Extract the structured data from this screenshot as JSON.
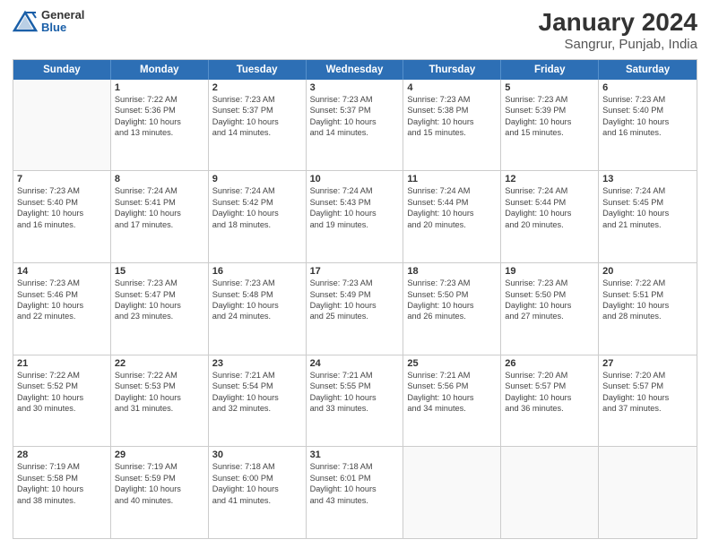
{
  "header": {
    "logo": {
      "general": "General",
      "blue": "Blue"
    },
    "title": "January 2024",
    "subtitle": "Sangrur, Punjab, India"
  },
  "days_of_week": [
    "Sunday",
    "Monday",
    "Tuesday",
    "Wednesday",
    "Thursday",
    "Friday",
    "Saturday"
  ],
  "weeks": [
    [
      {
        "day": "",
        "sunrise": "",
        "sunset": "",
        "daylight": "",
        "empty": true
      },
      {
        "day": "1",
        "sunrise": "Sunrise: 7:22 AM",
        "sunset": "Sunset: 5:36 PM",
        "daylight1": "Daylight: 10 hours",
        "daylight2": "and 13 minutes."
      },
      {
        "day": "2",
        "sunrise": "Sunrise: 7:23 AM",
        "sunset": "Sunset: 5:37 PM",
        "daylight1": "Daylight: 10 hours",
        "daylight2": "and 14 minutes."
      },
      {
        "day": "3",
        "sunrise": "Sunrise: 7:23 AM",
        "sunset": "Sunset: 5:37 PM",
        "daylight1": "Daylight: 10 hours",
        "daylight2": "and 14 minutes."
      },
      {
        "day": "4",
        "sunrise": "Sunrise: 7:23 AM",
        "sunset": "Sunset: 5:38 PM",
        "daylight1": "Daylight: 10 hours",
        "daylight2": "and 15 minutes."
      },
      {
        "day": "5",
        "sunrise": "Sunrise: 7:23 AM",
        "sunset": "Sunset: 5:39 PM",
        "daylight1": "Daylight: 10 hours",
        "daylight2": "and 15 minutes."
      },
      {
        "day": "6",
        "sunrise": "Sunrise: 7:23 AM",
        "sunset": "Sunset: 5:40 PM",
        "daylight1": "Daylight: 10 hours",
        "daylight2": "and 16 minutes."
      }
    ],
    [
      {
        "day": "7",
        "sunrise": "Sunrise: 7:23 AM",
        "sunset": "Sunset: 5:40 PM",
        "daylight1": "Daylight: 10 hours",
        "daylight2": "and 16 minutes."
      },
      {
        "day": "8",
        "sunrise": "Sunrise: 7:24 AM",
        "sunset": "Sunset: 5:41 PM",
        "daylight1": "Daylight: 10 hours",
        "daylight2": "and 17 minutes."
      },
      {
        "day": "9",
        "sunrise": "Sunrise: 7:24 AM",
        "sunset": "Sunset: 5:42 PM",
        "daylight1": "Daylight: 10 hours",
        "daylight2": "and 18 minutes."
      },
      {
        "day": "10",
        "sunrise": "Sunrise: 7:24 AM",
        "sunset": "Sunset: 5:43 PM",
        "daylight1": "Daylight: 10 hours",
        "daylight2": "and 19 minutes."
      },
      {
        "day": "11",
        "sunrise": "Sunrise: 7:24 AM",
        "sunset": "Sunset: 5:44 PM",
        "daylight1": "Daylight: 10 hours",
        "daylight2": "and 20 minutes."
      },
      {
        "day": "12",
        "sunrise": "Sunrise: 7:24 AM",
        "sunset": "Sunset: 5:44 PM",
        "daylight1": "Daylight: 10 hours",
        "daylight2": "and 20 minutes."
      },
      {
        "day": "13",
        "sunrise": "Sunrise: 7:24 AM",
        "sunset": "Sunset: 5:45 PM",
        "daylight1": "Daylight: 10 hours",
        "daylight2": "and 21 minutes."
      }
    ],
    [
      {
        "day": "14",
        "sunrise": "Sunrise: 7:23 AM",
        "sunset": "Sunset: 5:46 PM",
        "daylight1": "Daylight: 10 hours",
        "daylight2": "and 22 minutes."
      },
      {
        "day": "15",
        "sunrise": "Sunrise: 7:23 AM",
        "sunset": "Sunset: 5:47 PM",
        "daylight1": "Daylight: 10 hours",
        "daylight2": "and 23 minutes."
      },
      {
        "day": "16",
        "sunrise": "Sunrise: 7:23 AM",
        "sunset": "Sunset: 5:48 PM",
        "daylight1": "Daylight: 10 hours",
        "daylight2": "and 24 minutes."
      },
      {
        "day": "17",
        "sunrise": "Sunrise: 7:23 AM",
        "sunset": "Sunset: 5:49 PM",
        "daylight1": "Daylight: 10 hours",
        "daylight2": "and 25 minutes."
      },
      {
        "day": "18",
        "sunrise": "Sunrise: 7:23 AM",
        "sunset": "Sunset: 5:50 PM",
        "daylight1": "Daylight: 10 hours",
        "daylight2": "and 26 minutes."
      },
      {
        "day": "19",
        "sunrise": "Sunrise: 7:23 AM",
        "sunset": "Sunset: 5:50 PM",
        "daylight1": "Daylight: 10 hours",
        "daylight2": "and 27 minutes."
      },
      {
        "day": "20",
        "sunrise": "Sunrise: 7:22 AM",
        "sunset": "Sunset: 5:51 PM",
        "daylight1": "Daylight: 10 hours",
        "daylight2": "and 28 minutes."
      }
    ],
    [
      {
        "day": "21",
        "sunrise": "Sunrise: 7:22 AM",
        "sunset": "Sunset: 5:52 PM",
        "daylight1": "Daylight: 10 hours",
        "daylight2": "and 30 minutes."
      },
      {
        "day": "22",
        "sunrise": "Sunrise: 7:22 AM",
        "sunset": "Sunset: 5:53 PM",
        "daylight1": "Daylight: 10 hours",
        "daylight2": "and 31 minutes."
      },
      {
        "day": "23",
        "sunrise": "Sunrise: 7:21 AM",
        "sunset": "Sunset: 5:54 PM",
        "daylight1": "Daylight: 10 hours",
        "daylight2": "and 32 minutes."
      },
      {
        "day": "24",
        "sunrise": "Sunrise: 7:21 AM",
        "sunset": "Sunset: 5:55 PM",
        "daylight1": "Daylight: 10 hours",
        "daylight2": "and 33 minutes."
      },
      {
        "day": "25",
        "sunrise": "Sunrise: 7:21 AM",
        "sunset": "Sunset: 5:56 PM",
        "daylight1": "Daylight: 10 hours",
        "daylight2": "and 34 minutes."
      },
      {
        "day": "26",
        "sunrise": "Sunrise: 7:20 AM",
        "sunset": "Sunset: 5:57 PM",
        "daylight1": "Daylight: 10 hours",
        "daylight2": "and 36 minutes."
      },
      {
        "day": "27",
        "sunrise": "Sunrise: 7:20 AM",
        "sunset": "Sunset: 5:57 PM",
        "daylight1": "Daylight: 10 hours",
        "daylight2": "and 37 minutes."
      }
    ],
    [
      {
        "day": "28",
        "sunrise": "Sunrise: 7:19 AM",
        "sunset": "Sunset: 5:58 PM",
        "daylight1": "Daylight: 10 hours",
        "daylight2": "and 38 minutes."
      },
      {
        "day": "29",
        "sunrise": "Sunrise: 7:19 AM",
        "sunset": "Sunset: 5:59 PM",
        "daylight1": "Daylight: 10 hours",
        "daylight2": "and 40 minutes."
      },
      {
        "day": "30",
        "sunrise": "Sunrise: 7:18 AM",
        "sunset": "Sunset: 6:00 PM",
        "daylight1": "Daylight: 10 hours",
        "daylight2": "and 41 minutes."
      },
      {
        "day": "31",
        "sunrise": "Sunrise: 7:18 AM",
        "sunset": "Sunset: 6:01 PM",
        "daylight1": "Daylight: 10 hours",
        "daylight2": "and 43 minutes."
      },
      {
        "day": "",
        "sunrise": "",
        "sunset": "",
        "daylight1": "",
        "daylight2": "",
        "empty": true
      },
      {
        "day": "",
        "sunrise": "",
        "sunset": "",
        "daylight1": "",
        "daylight2": "",
        "empty": true
      },
      {
        "day": "",
        "sunrise": "",
        "sunset": "",
        "daylight1": "",
        "daylight2": "",
        "empty": true
      }
    ]
  ]
}
